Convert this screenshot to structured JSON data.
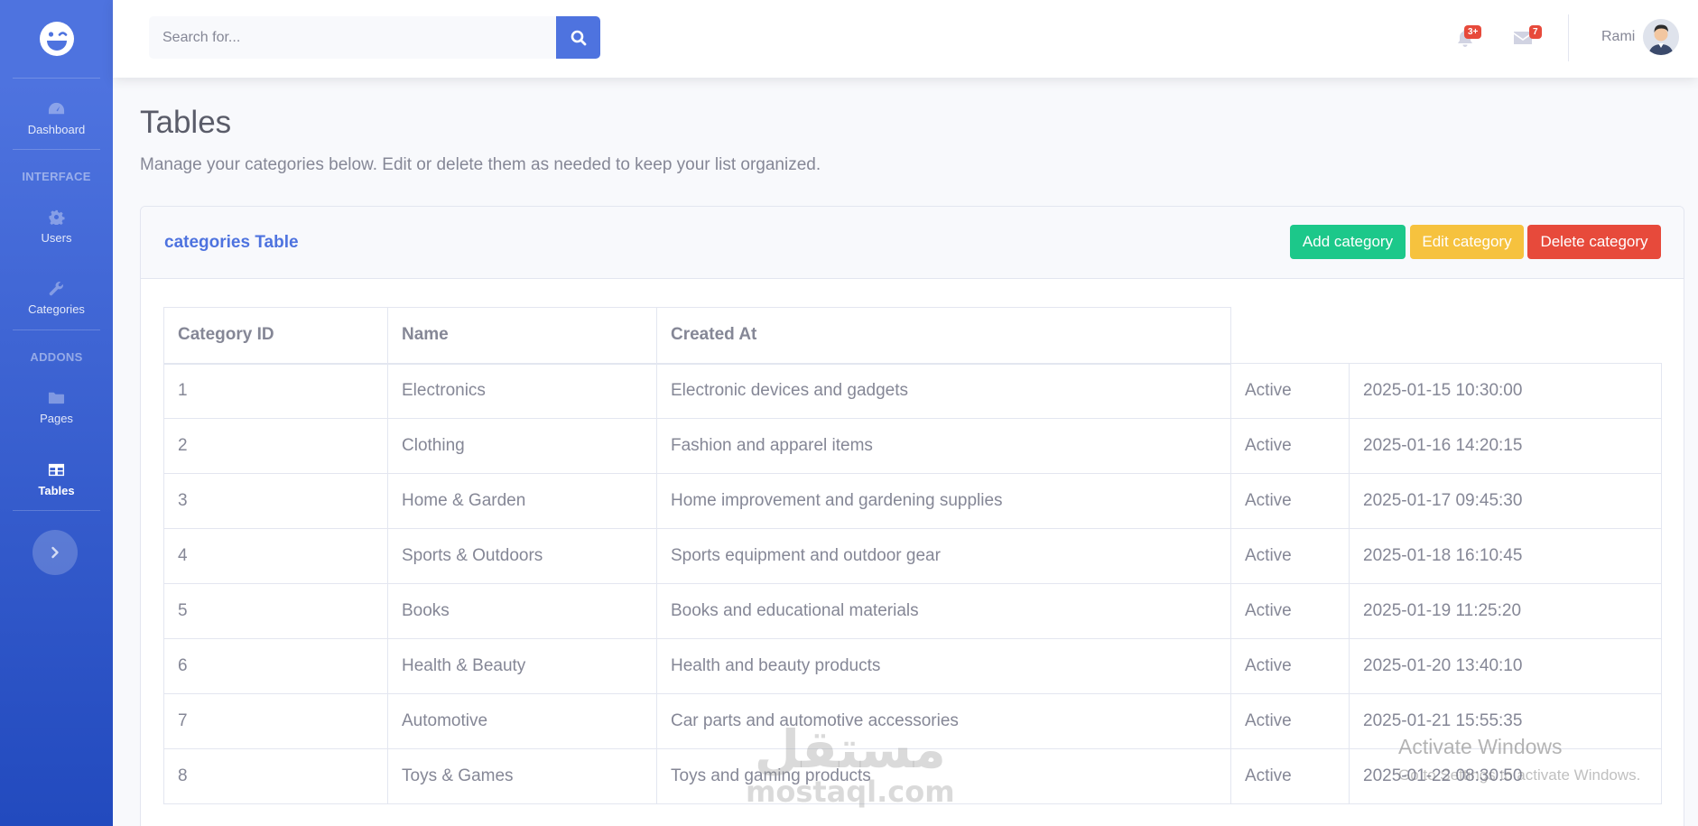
{
  "sidebar": {
    "headings": {
      "interface": "INTERFACE",
      "addons": "ADDONS"
    },
    "items": [
      {
        "label": "Dashboard",
        "icon": "tachometer-icon"
      },
      {
        "label": "Users",
        "icon": "cog-icon"
      },
      {
        "label": "Categories",
        "icon": "wrench-icon"
      },
      {
        "label": "Pages",
        "icon": "folder-icon"
      },
      {
        "label": "Tables",
        "icon": "table-icon",
        "active": true
      }
    ]
  },
  "topbar": {
    "search_placeholder": "Search for...",
    "alerts_badge": "3+",
    "messages_badge": "7",
    "user_name": "Rami"
  },
  "page": {
    "title": "Tables",
    "description": "Manage your categories below. Edit or delete them as needed to keep your list organized."
  },
  "card": {
    "title": "categories Table",
    "add_label": "Add category",
    "edit_label": "Edit category",
    "delete_label": "Delete category"
  },
  "table": {
    "columns": [
      "Category ID",
      "Name",
      "Created At"
    ],
    "rows": [
      [
        "1",
        "Electronics",
        "Electronic devices and gadgets",
        "Active",
        "2025-01-15 10:30:00"
      ],
      [
        "2",
        "Clothing",
        "Fashion and apparel items",
        "Active",
        "2025-01-16 14:20:15"
      ],
      [
        "3",
        "Home & Garden",
        "Home improvement and gardening supplies",
        "Active",
        "2025-01-17 09:45:30"
      ],
      [
        "4",
        "Sports & Outdoors",
        "Sports equipment and outdoor gear",
        "Active",
        "2025-01-18 16:10:45"
      ],
      [
        "5",
        "Books",
        "Books and educational materials",
        "Active",
        "2025-01-19 11:25:20"
      ],
      [
        "6",
        "Health & Beauty",
        "Health and beauty products",
        "Active",
        "2025-01-20 13:40:10"
      ],
      [
        "7",
        "Automotive",
        "Car parts and automotive accessories",
        "Active",
        "2025-01-21 15:55:35"
      ],
      [
        "8",
        "Toys & Games",
        "Toys and gaming products",
        "Active",
        "2025-01-22 08:30:50"
      ]
    ]
  },
  "overlay": {
    "activate_title": "Activate Windows",
    "activate_sub": "Go to Settings to activate Windows.",
    "watermark_ar": "مستقل",
    "watermark_en": "mostaql.com"
  },
  "colors": {
    "primary": "#4e73df",
    "success": "#1cc88a",
    "warning": "#f6c23e",
    "danger": "#e74a3b"
  }
}
